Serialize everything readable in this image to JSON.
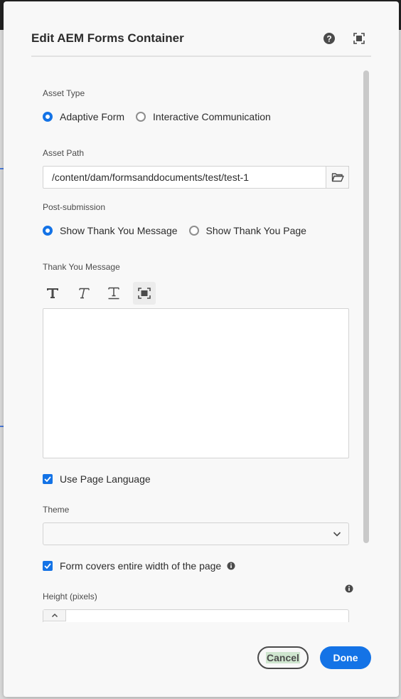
{
  "dialog": {
    "title": "Edit AEM Forms Container",
    "icons": {
      "help": "help-circle-icon",
      "fullscreen": "fullscreen-icon"
    }
  },
  "form": {
    "asset_type": {
      "label": "Asset Type",
      "options": [
        {
          "label": "Adaptive Form",
          "selected": true
        },
        {
          "label": "Interactive Communication",
          "selected": false
        }
      ]
    },
    "asset_path": {
      "label": "Asset Path",
      "value": "/content/dam/formsanddocuments/test/test-1",
      "browse_icon": "folder-icon"
    },
    "post_submission": {
      "label": "Post-submission",
      "options": [
        {
          "label": "Show Thank You Message",
          "selected": true
        },
        {
          "label": "Show Thank You Page",
          "selected": false
        }
      ]
    },
    "thank_you_message": {
      "label": "Thank You Message",
      "toolbar": [
        "text-bold-icon",
        "text-italic-icon",
        "text-underline-icon",
        "fullscreen-icon"
      ],
      "value": ""
    },
    "use_page_language": {
      "label": "Use Page Language",
      "checked": true
    },
    "theme": {
      "label": "Theme",
      "value": ""
    },
    "form_covers_width": {
      "label": "Form covers entire width of the page",
      "checked": true
    },
    "height": {
      "label": "Height (pixels)",
      "value": ""
    }
  },
  "footer": {
    "cancel_label": "Cancel",
    "done_label": "Done"
  },
  "colors": {
    "accent": "#1473e6",
    "background": "#f8f8f8"
  }
}
